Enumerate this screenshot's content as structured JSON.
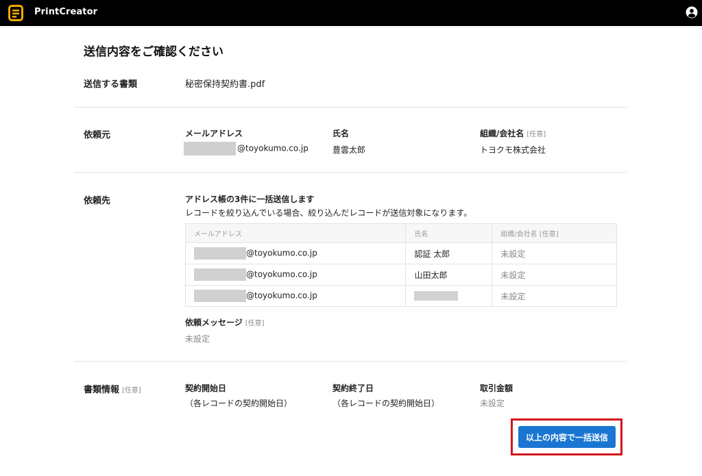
{
  "header": {
    "app_title": "PrintCreator"
  },
  "page": {
    "title": "送信内容をご確認ください"
  },
  "document": {
    "label": "送信する書類",
    "name": "秘密保持契約書.pdf"
  },
  "requester": {
    "label": "依頼元",
    "email_label": "メールアドレス",
    "email_domain": "@toyokumo.co.jp",
    "name_label": "氏名",
    "name_value": "豊雲太郎",
    "org_label": "組織/会社名",
    "org_optional": "[任意]",
    "org_value": "トヨクモ株式会社"
  },
  "recipients": {
    "label": "依頼先",
    "notice_title": "アドレス帳の3件に一括送信します",
    "notice_sub": "レコードを絞り込んでいる場合、絞り込んだレコードが送信対象になります。",
    "headers": [
      "メールアドレス",
      "氏名",
      "組織/会社名 [任意]"
    ],
    "rows": [
      {
        "email": "@toyokumo.co.jp",
        "name": "認証 太郎",
        "org": "未設定"
      },
      {
        "email": "@toyokumo.co.jp",
        "name": "山田太郎",
        "org": "未設定"
      },
      {
        "email": "@toyokumo.co.jp",
        "name": "",
        "org": "未設定"
      }
    ],
    "message_label": "依頼メッセージ",
    "message_optional": "[任意]",
    "message_value": "未設定"
  },
  "doc_info": {
    "label": "書類情報",
    "optional": "[任意]",
    "start_label": "契約開始日",
    "start_value": "（各レコードの契約開始日）",
    "end_label": "契約終了日",
    "end_value": "（各レコードの契約開始日）",
    "amount_label": "取引金額",
    "amount_value": "未設定"
  },
  "actions": {
    "submit_label": "以上の内容で一括送信"
  },
  "colors": {
    "header_bg": "#000000",
    "accent": "#1a76d2",
    "logo": "#f5a800",
    "highlight": "#d4141d"
  }
}
